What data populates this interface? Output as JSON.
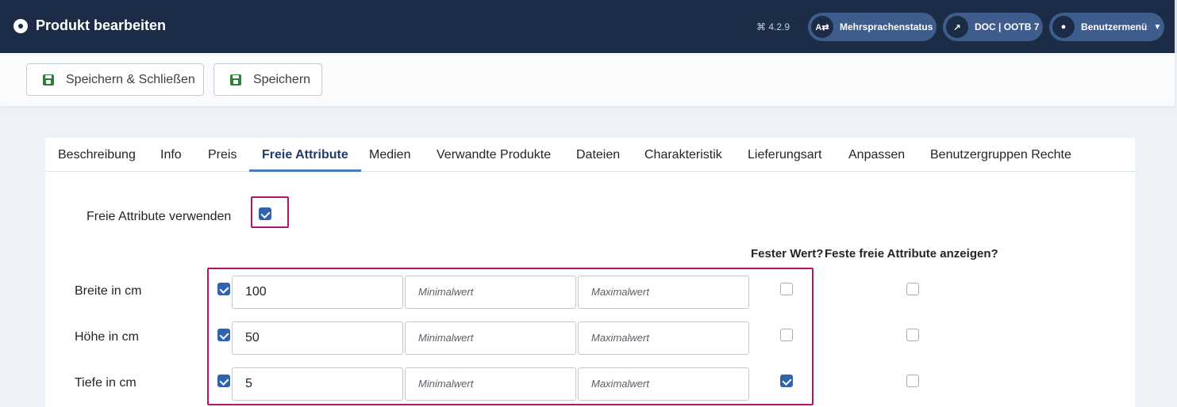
{
  "header": {
    "title": "Produkt bearbeiten",
    "version": "⌘ 4.2.9",
    "lang_status": "Mehrsprachenstatus",
    "lang_icon": "A⇄",
    "doc": "DOC | OOTB 7",
    "user_menu": "Benutzermenü"
  },
  "toolbar": {
    "save_close_label": "Speichern & Schließen",
    "save_label": "Speichern"
  },
  "tabs": [
    {
      "label": "Beschreibung"
    },
    {
      "label": "Info"
    },
    {
      "label": "Preis"
    },
    {
      "label": "Freie Attribute",
      "active": true
    },
    {
      "label": "Medien"
    },
    {
      "label": "Verwandte Produkte"
    },
    {
      "label": "Dateien"
    },
    {
      "label": "Charakteristik"
    },
    {
      "label": "Lieferungsart"
    },
    {
      "label": "Anpassen"
    },
    {
      "label": "Benutzergruppen Rechte"
    }
  ],
  "form": {
    "use_free_attributes_label": "Freie Attribute verwenden",
    "use_free_attributes_checked": true,
    "col_fixed_value": "Fester Wert?",
    "col_show_fixed": "Feste freie Attribute anzeigen?",
    "min_placeholder": "Minimalwert",
    "max_placeholder": "Maximalwert",
    "rows": [
      {
        "label": "Breite in cm",
        "enabled": true,
        "value": "100",
        "fixed": false,
        "show_fixed": false
      },
      {
        "label": "Höhe in cm",
        "enabled": true,
        "value": "50",
        "fixed": false,
        "show_fixed": false
      },
      {
        "label": "Tiefe in cm",
        "enabled": true,
        "value": "5",
        "fixed": true,
        "show_fixed": false
      }
    ]
  },
  "colors": {
    "header_bg": "#1c2c46",
    "pill_bg": "#3e5d8c",
    "checkbox_checked": "#2f62b0",
    "highlight": "#b0166a",
    "save_icon": "#2f7d3b"
  }
}
